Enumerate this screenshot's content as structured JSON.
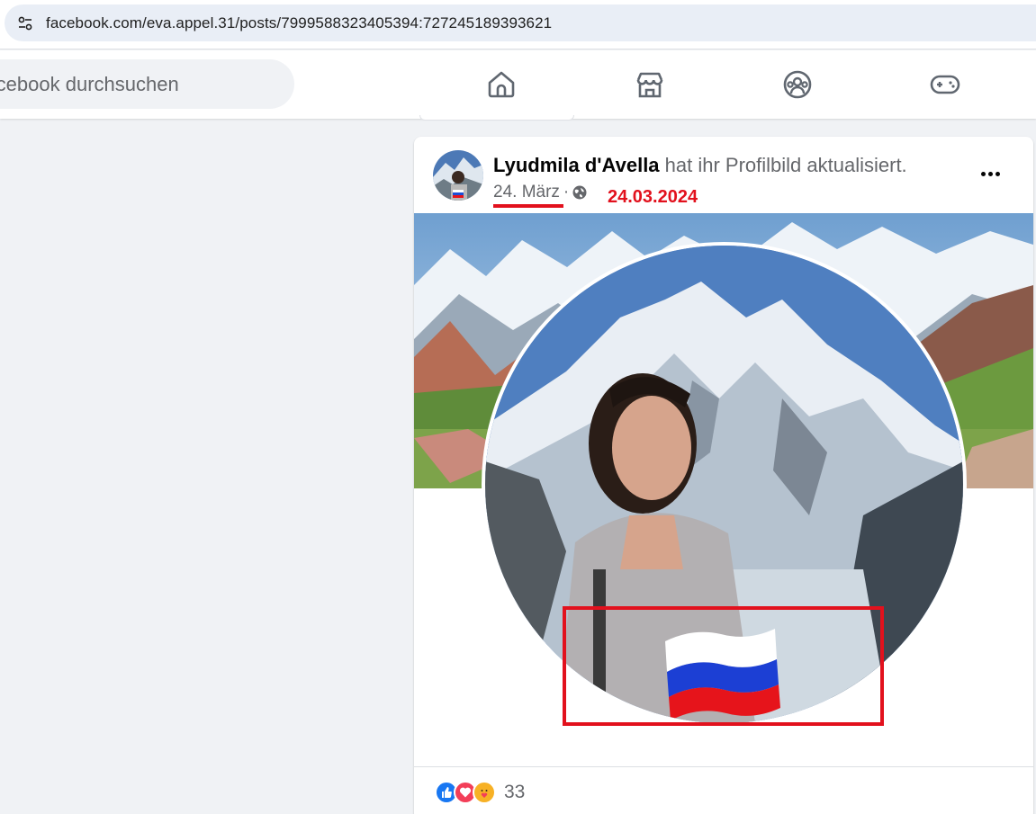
{
  "browser": {
    "url": "facebook.com/eva.appel.31/posts/7999588323405394:727245189393621"
  },
  "nav": {
    "search_placeholder": "Facebook durchsuchen",
    "icons": [
      "home-icon",
      "marketplace-icon",
      "groups-icon",
      "gaming-icon"
    ]
  },
  "post": {
    "author": "Lyudmila d'Avella",
    "action": " hat ihr Profilbild aktualisiert.",
    "date": "24. März",
    "separator": "·",
    "annotation_date": "24.03.2024",
    "reaction_count": "33",
    "reactions": [
      "like-icon",
      "love-icon",
      "care-icon"
    ]
  },
  "colors": {
    "annotation_red": "#e2111d",
    "like_blue": "#1877f2",
    "love_red": "#f33e58",
    "care_yellow": "#f7b125"
  }
}
